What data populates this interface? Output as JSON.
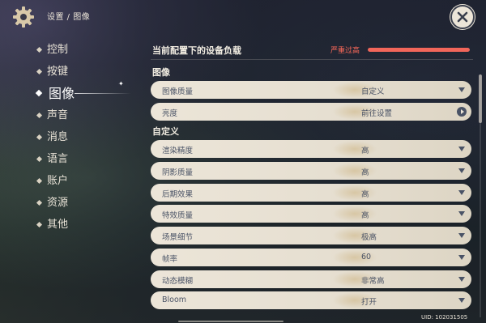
{
  "header": {
    "breadcrumb": "设置 / 图像"
  },
  "sidebar": {
    "items": [
      {
        "label": "控制",
        "active": false
      },
      {
        "label": "按键",
        "active": false
      },
      {
        "label": "图像",
        "active": true
      },
      {
        "label": "声音",
        "active": false
      },
      {
        "label": "消息",
        "active": false
      },
      {
        "label": "语言",
        "active": false
      },
      {
        "label": "账户",
        "active": false
      },
      {
        "label": "资源",
        "active": false
      },
      {
        "label": "其他",
        "active": false
      }
    ]
  },
  "load": {
    "title": "当前配置下的设备负载",
    "status": "严重过高",
    "level_percent": 100,
    "bar_color": "#f2665a",
    "status_color": "#ff6a5a"
  },
  "image_section": {
    "title": "图像",
    "rows": [
      {
        "label": "图像质量",
        "value": "自定义",
        "control": "dropdown"
      },
      {
        "label": "亮度",
        "value": "前往设置",
        "control": "link"
      }
    ]
  },
  "custom_section": {
    "title": "自定义",
    "rows": [
      {
        "label": "渲染精度",
        "value": "高",
        "control": "dropdown"
      },
      {
        "label": "阴影质量",
        "value": "高",
        "control": "dropdown"
      },
      {
        "label": "后期效果",
        "value": "高",
        "control": "dropdown"
      },
      {
        "label": "特效质量",
        "value": "高",
        "control": "dropdown"
      },
      {
        "label": "场景细节",
        "value": "极高",
        "control": "dropdown"
      },
      {
        "label": "帧率",
        "value": "60",
        "control": "dropdown"
      },
      {
        "label": "动态模糊",
        "value": "非常高",
        "control": "dropdown"
      },
      {
        "label": "Bloom",
        "value": "打开",
        "control": "dropdown"
      }
    ]
  },
  "footer": {
    "uid": "UID: 102031505"
  },
  "icons": {
    "settings": "gear-icon",
    "close": "close-icon",
    "dropdown": "chevron-down-icon",
    "link": "arrow-right-circle-icon"
  }
}
